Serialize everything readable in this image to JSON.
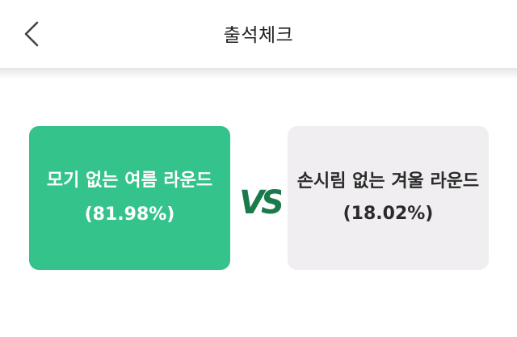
{
  "header": {
    "title": "출석체크",
    "back_icon": "chevron-left-icon"
  },
  "vote": {
    "left": {
      "label": "모기 없는 여름 라운드",
      "percent": "(81.98%)",
      "color": "#34c38b"
    },
    "right": {
      "label": "손시림 없는 겨울 라운드",
      "percent": "(18.02%)",
      "color": "#f0eef0"
    },
    "vs_label": "VS",
    "vs_color": "#1a7a4c"
  }
}
